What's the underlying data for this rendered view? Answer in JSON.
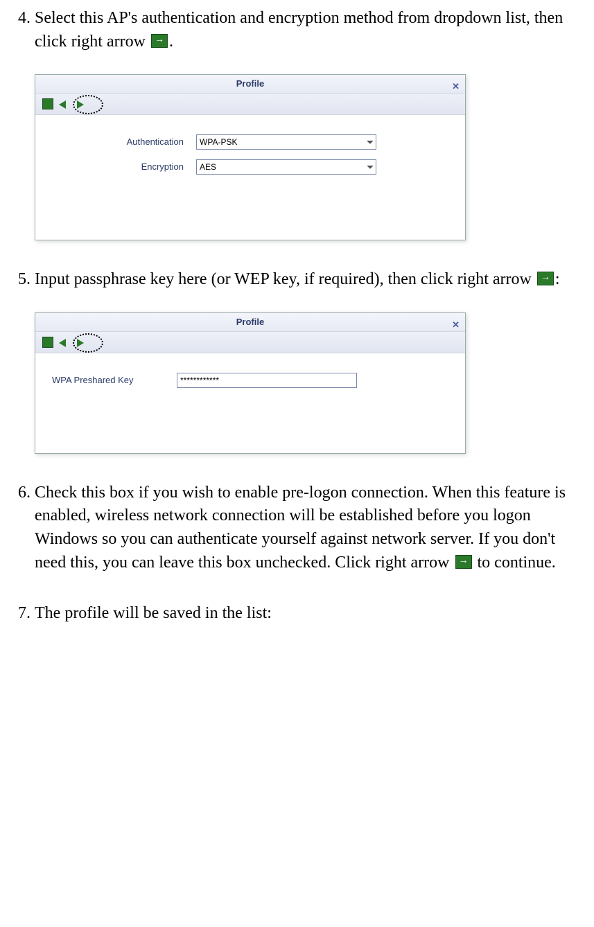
{
  "steps": {
    "s4": "Select this AP's authentication and encryption method from dropdown list, then click right arrow ",
    "s4_tail": ".",
    "s5": "Input passphrase key here (or WEP key, if required), then click right arrow ",
    "s5_tail": ":",
    "s6a": "Check this box if you wish to enable pre-logon connection. When this feature is enabled, wireless network connection will be established before you logon Windows so you can authenticate yourself against network server. If you don't need this, you can leave this box unchecked. Click right arrow ",
    "s6b": " to continue.",
    "s7": "The profile will be saved in the list:"
  },
  "dialog1": {
    "title": "Profile",
    "auth_label": "Authentication",
    "enc_label": "Encryption",
    "auth_value": "WPA-PSK",
    "enc_value": "AES"
  },
  "dialog2": {
    "title": "Profile",
    "key_label": "WPA Preshared Key",
    "key_value": "************"
  }
}
